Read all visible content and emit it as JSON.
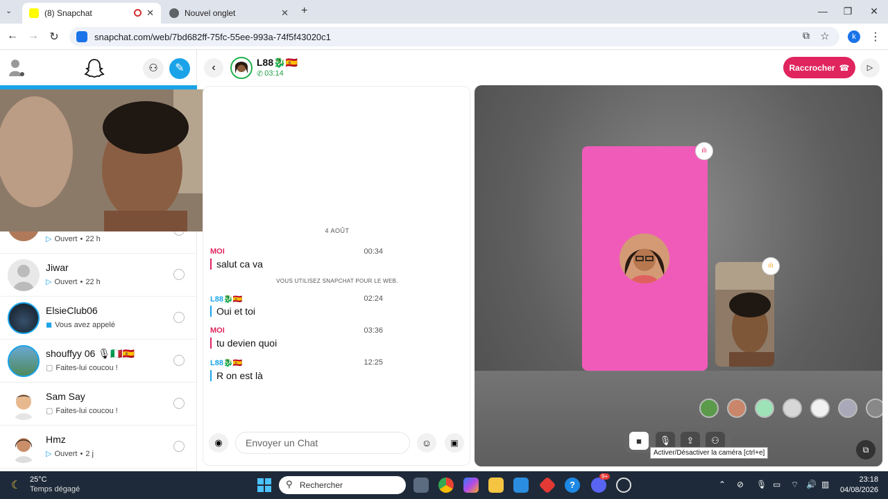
{
  "browser": {
    "tabs": [
      {
        "label": "(8) Snapchat",
        "active": true
      },
      {
        "label": "Nouvel onglet",
        "active": false
      }
    ],
    "new_tab": "+",
    "url": "snapchat.com/web/7bd682ff-75fc-55ee-993a-74f5f43020c1",
    "profile_initial": "k",
    "window_controls": {
      "minimize": "—",
      "restore": "❐",
      "close": "✕"
    }
  },
  "sidebar": {
    "chats": [
      {
        "name": "",
        "status_icon": "arrow",
        "status": "Ouvert",
        "time": "22 h"
      },
      {
        "name": "Jiwar",
        "status_icon": "arrow",
        "status": "Ouvert",
        "time": "22 h"
      },
      {
        "name": "ElsieClub06",
        "status_icon": "call",
        "status": "Vous avez appelé",
        "time": ""
      },
      {
        "name": "shouffyy 06 🎙🇮🇹🇪🇸",
        "status_icon": "chat",
        "status": "Faites-lui coucou !",
        "time": ""
      },
      {
        "name": "Sam Say",
        "status_icon": "chat",
        "status": "Faites-lui coucou !",
        "time": ""
      },
      {
        "name": "Hmz",
        "status_icon": "arrow",
        "status": "Ouvert",
        "time": "2 j"
      }
    ]
  },
  "conversation": {
    "name": "L88🐉🇪🇸",
    "call_duration": "03:14",
    "hangup_label": "Raccrocher",
    "date_divider": "4 AOÛT",
    "system_note": "VOUS UTILISEZ SNAPCHAT POUR LE WEB.",
    "messages": [
      {
        "sender": "MOI",
        "time": "00:34",
        "text": "salut ca va",
        "color": "#e0245e"
      },
      {
        "sender": "L88🐉🇪🇸",
        "time": "02:24",
        "text": "Oui et toi",
        "color": "#1aa3e8"
      },
      {
        "sender": "MOI",
        "time": "03:36",
        "text": "tu devien quoi",
        "color": "#e0245e"
      },
      {
        "sender": "L88🐉🇪🇸",
        "time": "12:25",
        "text": "R on est là",
        "color": "#1aa3e8"
      }
    ],
    "composer_placeholder": "Envoyer un Chat"
  },
  "call": {
    "tooltip": "Activer/Désactiver la caméra [ctrl+e]",
    "tile_color": "#f05bb9"
  },
  "taskbar": {
    "weather_temp": "25°C",
    "weather_desc": "Temps dégagé",
    "search_placeholder": "Rechercher",
    "time": "23:18",
    "date": "04/08/2026",
    "discord_badge": "9+"
  }
}
